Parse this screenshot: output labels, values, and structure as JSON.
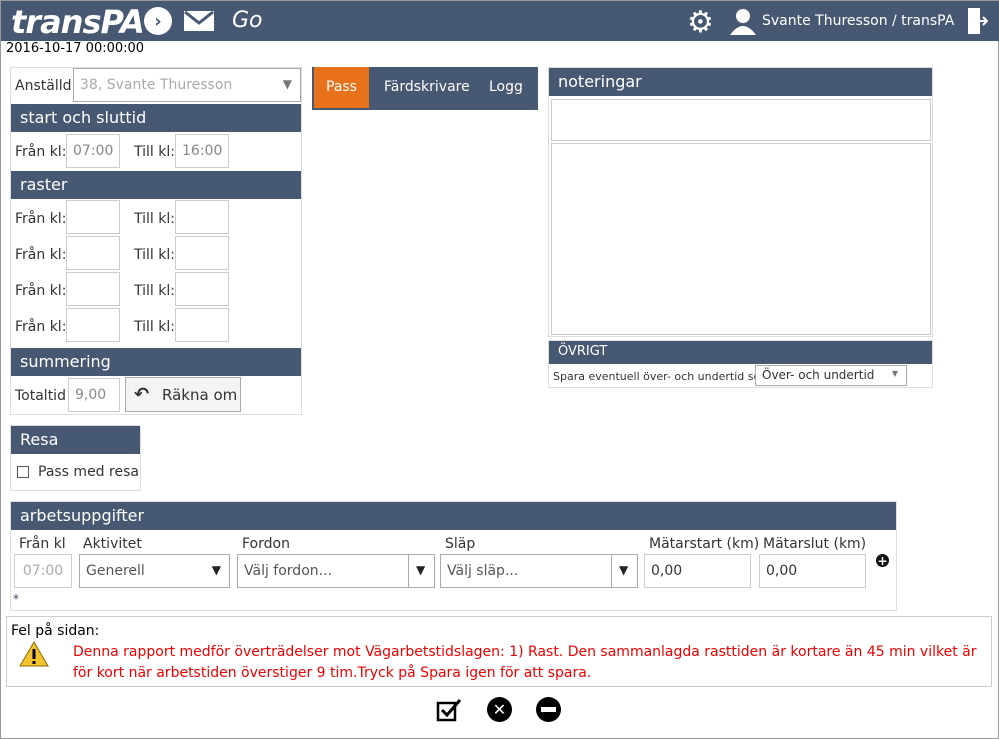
{
  "header": {
    "logo": "transPA",
    "go": "Go",
    "user": "Svante Thuresson / transPA"
  },
  "date": "2016-10-17 00:00:00",
  "employee": {
    "label": "Anställd",
    "value": "38, Svante Thuresson"
  },
  "start_end": {
    "title": "start och sluttid",
    "from_label": "Från kl:",
    "from": "07:00",
    "to_label": "Till kl:",
    "to": "16:00"
  },
  "breaks": {
    "title": "raster",
    "from_label": "Från kl:",
    "to_label": "Till kl:"
  },
  "summary": {
    "title": "summering",
    "total_label": "Totaltid",
    "total": "9,00",
    "recalc": "Räkna om"
  },
  "tabs": [
    {
      "label": "Pass"
    },
    {
      "label": "Färdskrivare"
    },
    {
      "label": "Logg"
    }
  ],
  "notes": {
    "title": "noteringar"
  },
  "other": {
    "title": "ÖVRIGT",
    "text": "Spara eventuell över- och undertid som",
    "select": "Över- och undertid"
  },
  "trip": {
    "title": "Resa",
    "checkbox": "Pass med resa"
  },
  "tasks": {
    "title": "arbetsuppgifter",
    "cols": [
      "Från kl",
      "Aktivitet",
      "Fordon",
      "Släp",
      "Mätarstart (km)",
      "Mätarslut (km)"
    ],
    "from": "07:00",
    "activity": "Generell",
    "vehicle_ph": "Välj fordon...",
    "trailer_ph": "Välj släp...",
    "start": "0,00",
    "end": "0,00",
    "star": "*"
  },
  "error": {
    "title": "Fel på sidan:",
    "message": "Denna rapport medför överträdelser mot Vägarbetstidslagen: 1) Rast. Den sammanlagda rasttiden är kortare än 45 min vilket är för kort när arbetstiden överstiger 9 tim.Tryck på Spara igen för att spara."
  }
}
